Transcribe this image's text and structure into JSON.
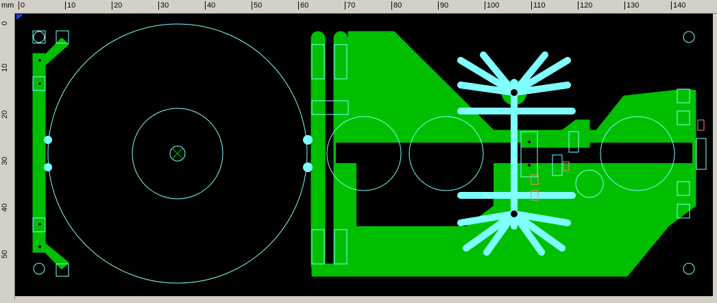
{
  "ruler": {
    "unit": "mm",
    "top_labels": [
      "0",
      "10",
      "20",
      "30",
      "40",
      "50",
      "60",
      "70",
      "80",
      "90",
      "100",
      "110",
      "120",
      "130",
      "140"
    ],
    "left_labels": [
      "0",
      "10",
      "20",
      "30",
      "40",
      "50"
    ]
  },
  "colors": {
    "background": "#000000",
    "copper": "#00bf00",
    "silk": "#80ffff",
    "resistor": "#ff8080"
  }
}
